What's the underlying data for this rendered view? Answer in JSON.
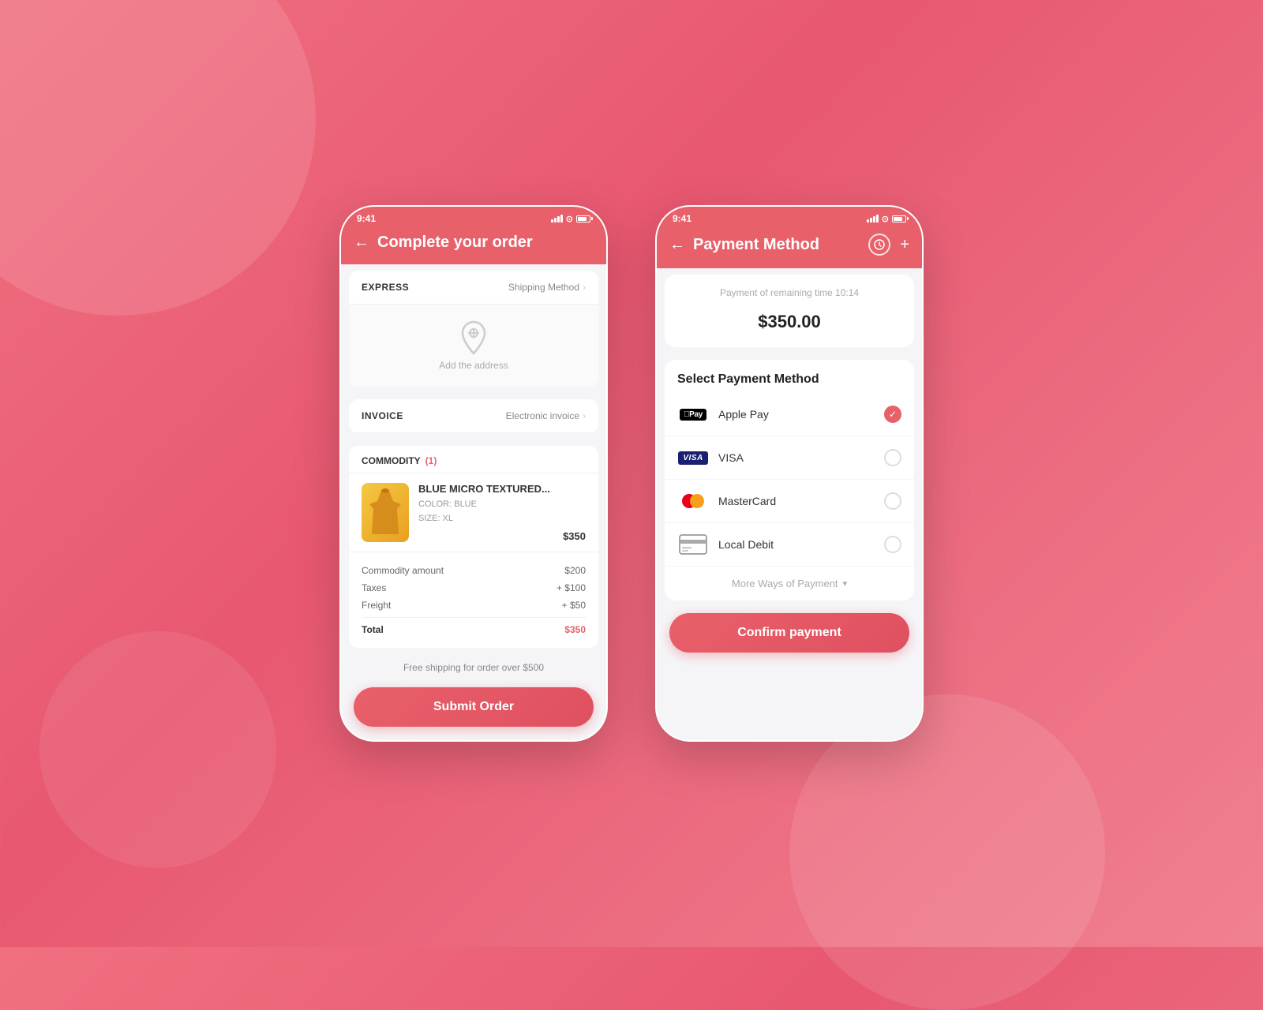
{
  "background": {
    "gradient_start": "#f07080",
    "gradient_end": "#f08090"
  },
  "phone1": {
    "status_bar": {
      "time": "9:41"
    },
    "header": {
      "title": "Complete your order",
      "back_label": "←"
    },
    "express_section": {
      "label": "EXPRESS",
      "right_text": "Shipping Method"
    },
    "address_section": {
      "placeholder": "Add the address"
    },
    "invoice_section": {
      "label": "INVOICE",
      "right_text": "Electronic invoice"
    },
    "commodity_section": {
      "label": "COMMODITY",
      "count": "(1)",
      "product": {
        "name": "BLUE MICRO TEXTURED...",
        "color": "COLOR: BLUE",
        "size": "SIZE: XL",
        "price": "$350"
      }
    },
    "summary": {
      "commodity_amount_label": "Commodity amount",
      "commodity_amount_value": "$200",
      "taxes_label": "Taxes",
      "taxes_value": "+ $100",
      "freight_label": "Freight",
      "freight_value": "+ $50",
      "total_label": "Total",
      "total_value": "$350"
    },
    "free_shipping_text": "Free shipping for order over $500",
    "submit_button": "Submit Order"
  },
  "phone2": {
    "status_bar": {
      "time": "9:41"
    },
    "header": {
      "title": "Payment Method",
      "back_label": "←"
    },
    "payment_card": {
      "timer_text": "Payment of remaining time 10:14",
      "amount": "$350.00",
      "currency_symbol": "$"
    },
    "payment_methods": {
      "section_title": "Select Payment Method",
      "options": [
        {
          "id": "apple-pay",
          "name": "Apple Pay",
          "selected": true
        },
        {
          "id": "visa",
          "name": "VISA",
          "selected": false
        },
        {
          "id": "mastercard",
          "name": "MasterCard",
          "selected": false
        },
        {
          "id": "local-debit",
          "name": "Local Debit",
          "selected": false
        }
      ],
      "more_ways_text": "More Ways of Payment"
    },
    "confirm_button": "Confirm payment"
  }
}
